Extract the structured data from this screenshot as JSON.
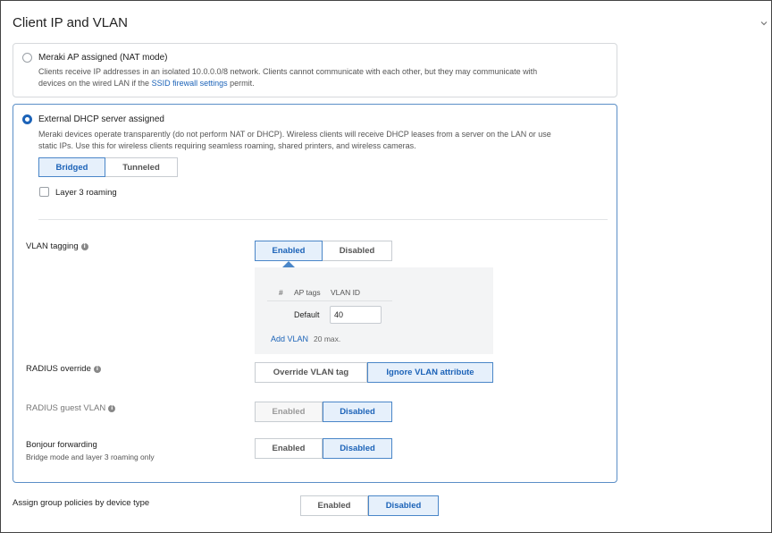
{
  "section_title": "Client IP and VLAN",
  "options": {
    "nat": {
      "label": "Meraki AP assigned (NAT mode)",
      "desc_line1": "Clients receive IP addresses in an isolated 10.0.0.0/8 network. Clients cannot communicate with each other, but they may communicate with",
      "desc_line2_pre": "devices on the wired LAN if the ",
      "desc_link": "SSID firewall settings",
      "desc_line2_post": " permit."
    },
    "dhcp": {
      "label": "External DHCP server assigned",
      "desc_line1": "Meraki devices operate transparently (do not perform NAT or DHCP). Wireless clients will receive DHCP leases from a server on the LAN or use",
      "desc_line2": "static IPs. Use this for wireless clients requiring seamless roaming, shared printers, and wireless cameras.",
      "mode_buttons": [
        "Bridged",
        "Tunneled"
      ],
      "layer3_label": "Layer 3 roaming"
    }
  },
  "vlan_tagging": {
    "label": "VLAN tagging",
    "buttons": [
      "Enabled",
      "Disabled"
    ],
    "table_headers": [
      "#",
      "AP tags",
      "VLAN ID"
    ],
    "row_label": "Default",
    "row_value": "40",
    "add_link": "Add VLAN",
    "max_note": "20 max."
  },
  "radius_override": {
    "label": "RADIUS override",
    "buttons": [
      "Override VLAN tag",
      "Ignore VLAN attribute"
    ]
  },
  "radius_guest_vlan": {
    "label": "RADIUS guest VLAN",
    "buttons": [
      "Enabled",
      "Disabled"
    ]
  },
  "bonjour": {
    "label": "Bonjour forwarding",
    "sublabel": "Bridge mode and layer 3 roaming only",
    "buttons": [
      "Enabled",
      "Disabled"
    ]
  },
  "group_policies": {
    "label": "Assign group policies by device type",
    "buttons": [
      "Enabled",
      "Disabled"
    ]
  },
  "colors": {
    "accent": "#1c63b8",
    "active_bg": "#e6f0fb",
    "border": "#c7ccd1"
  },
  "icons": [
    "info-icon",
    "chevron-down-icon"
  ]
}
